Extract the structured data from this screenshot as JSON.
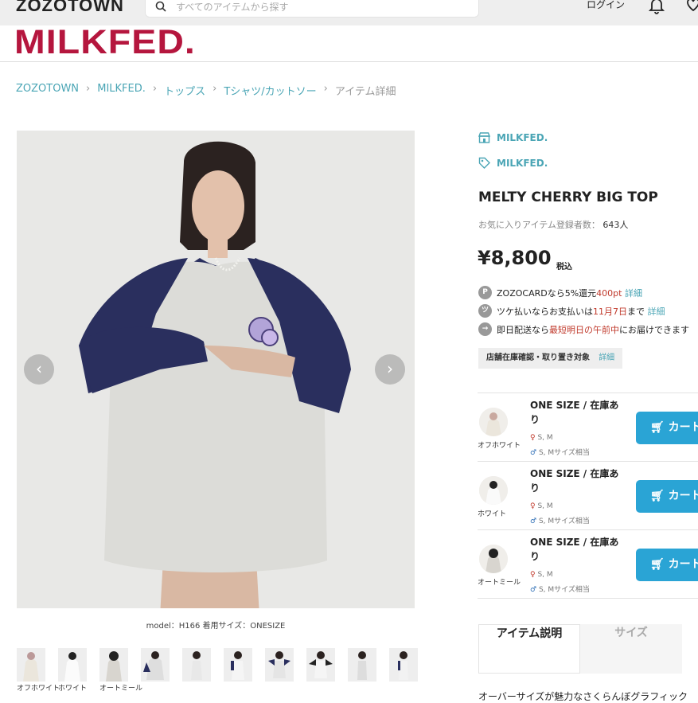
{
  "header": {
    "site_logo": "ZOZOTOWN",
    "search_placeholder": "すべてのアイテムから探す",
    "login": "ログイン"
  },
  "brand_logo": "MILKFED.",
  "breadcrumb": [
    {
      "label": "ZOZOTOWN"
    },
    {
      "label": "MILKFED."
    },
    {
      "label": "トップス"
    },
    {
      "label": "Tシャツ/カットソー"
    },
    {
      "label": "アイテム詳細"
    }
  ],
  "gallery": {
    "caption": "model：H166 着用サイズ：ONESIZE",
    "prev": "‹",
    "next": "›",
    "thumbs": [
      {
        "label": "オフホワイト"
      },
      {
        "label": "ホワイト"
      },
      {
        "label": "オートミール"
      },
      {
        "label": ""
      },
      {
        "label": ""
      },
      {
        "label": ""
      },
      {
        "label": ""
      },
      {
        "label": ""
      },
      {
        "label": ""
      },
      {
        "label": ""
      }
    ]
  },
  "product": {
    "shop": "MILKFED.",
    "brand": "MILKFED.",
    "name": "MELTY CHERRY BIG TOP",
    "fav_label": "お気に入りアイテム登録者数：",
    "fav_count": "643人",
    "price": "¥8,800",
    "tax": "税込",
    "zozocard": {
      "pre": "ZOZOCARDなら5%還元",
      "pt": "400pt",
      "link": "詳細"
    },
    "tsuke": {
      "pre": "ツケ払いならお支払いは",
      "date": "11月7日",
      "post": "まで",
      "link": "詳細"
    },
    "ship": {
      "pre": "即日配送なら",
      "hl": "最短明日の午前中",
      "post": "にお届けできます"
    },
    "store": {
      "label": "店舗在庫確認・取り置き対象",
      "link": "詳細"
    }
  },
  "skus": [
    {
      "color": "オフホワイト",
      "size": "ONE SIZE / 在庫あり",
      "m1": "S, M",
      "m2": "S, Mサイズ相当",
      "cart": "カート"
    },
    {
      "color": "ホワイト",
      "size": "ONE SIZE / 在庫あり",
      "m1": "S, M",
      "m2": "S, Mサイズ相当",
      "cart": "カート"
    },
    {
      "color": "オートミール",
      "size": "ONE SIZE / 在庫あり",
      "m1": "S, M",
      "m2": "S, Mサイズ相当",
      "cart": "カート"
    }
  ],
  "tabs": {
    "desc": "アイテム説明",
    "size": "サイズ"
  },
  "description_start": "オーバーサイズが魅力なさくらんぼグラフィック",
  "colors": {
    "brand": "#b5163e",
    "link": "#4aa5b5",
    "cart": "#2aa4d5",
    "navy": "#2a2f5e"
  }
}
